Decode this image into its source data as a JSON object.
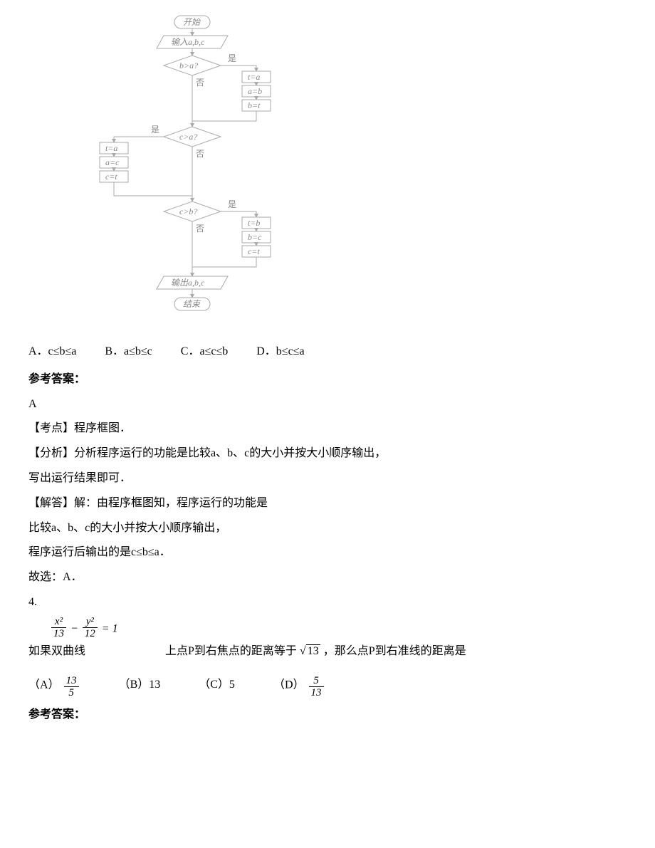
{
  "chart_data": {
    "type": "flowchart",
    "nodes": [
      {
        "id": "start",
        "shape": "terminator",
        "label": "开始"
      },
      {
        "id": "in",
        "shape": "io",
        "label": "输入a,b,c"
      },
      {
        "id": "d1",
        "shape": "decision",
        "label": "b>a?",
        "yes": "是",
        "no": "否"
      },
      {
        "id": "s1a",
        "shape": "process",
        "label": "t=a"
      },
      {
        "id": "s1b",
        "shape": "process",
        "label": "a=b"
      },
      {
        "id": "s1c",
        "shape": "process",
        "label": "b=t"
      },
      {
        "id": "d2",
        "shape": "decision",
        "label": "c>a?",
        "yes": "是",
        "no": "否"
      },
      {
        "id": "s2a",
        "shape": "process",
        "label": "t=a"
      },
      {
        "id": "s2b",
        "shape": "process",
        "label": "a=c"
      },
      {
        "id": "s2c",
        "shape": "process",
        "label": "c=t"
      },
      {
        "id": "d3",
        "shape": "decision",
        "label": "c>b?",
        "yes": "是",
        "no": "否"
      },
      {
        "id": "s3a",
        "shape": "process",
        "label": "t=b"
      },
      {
        "id": "s3b",
        "shape": "process",
        "label": "b=c"
      },
      {
        "id": "s3c",
        "shape": "process",
        "label": "c=t"
      },
      {
        "id": "out",
        "shape": "io",
        "label": "输出a,b,c"
      },
      {
        "id": "end",
        "shape": "terminator",
        "label": "结束"
      }
    ]
  },
  "q3": {
    "opts": {
      "A": "A．c≤b≤a",
      "B": "B．a≤b≤c",
      "C": "C．a≤c≤b",
      "D": "D．b≤c≤a"
    },
    "ref_head": "参考答案：",
    "ans": "A",
    "p1": "【考点】程序框图．",
    "p2": "【分析】分析程序运行的功能是比较a、b、c的大小并按大小顺序输出，",
    "p3": "写出运行结果即可．",
    "p4": "【解答】解：由程序框图知，程序运行的功能是",
    "p5": "比较a、b、c的大小并按大小顺序输出，",
    "p6": "程序运行后输出的是c≤b≤a．",
    "p7": "故选：A．"
  },
  "q4": {
    "num": "4.",
    "stem_pre": "如果双曲线",
    "frac1_num": "x²",
    "frac1_den": "13",
    "minus": " − ",
    "frac2_num": "y²",
    "frac2_den": "12",
    "eq1": " = 1",
    "stem_mid": " 上点P到右焦点的距离等于",
    "sqrt_val": "13",
    "stem_post": "，那么点P到右准线的距离是",
    "chA_l": "（A）",
    "chA_num": "13",
    "chA_den": "5",
    "chB": "（B）13",
    "chC": "（C）5",
    "chD_l": "（D）",
    "chD_num": "5",
    "chD_den": "13",
    "ref_head": "参考答案："
  }
}
